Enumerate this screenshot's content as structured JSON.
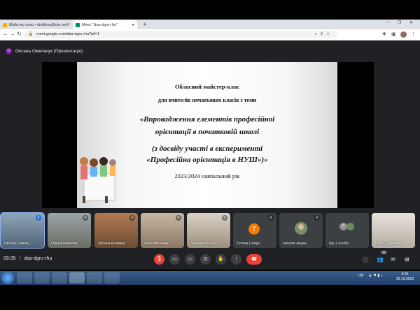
{
  "browser": {
    "tabs": [
      {
        "label": "Майстер клас • dishleva@ukr.net"
      },
      {
        "label": "Meet: \"dsa-dgru-rhu\""
      }
    ],
    "url": "meet.google.com/dsa-dgru-rhu?pli=1"
  },
  "meet": {
    "presenter": "Оксана Омельчук (Презентація)",
    "presenter_initial": "О",
    "slide": {
      "line1": "Обласний майстер-клас",
      "line2": "для вчителів початкових класів з теми",
      "line3": "«Впровадження елементів професійної",
      "line4": "орієнтації в початковій школі",
      "line5": "(з досвіду участі в експерименті",
      "line6": "«Професійна орієнтація в НУШ»)»",
      "line7": "2023/2024 навчальний рік"
    },
    "participants": [
      {
        "name": "Оксана Омель..."
      },
      {
        "name": "Олена Ковалев"
      },
      {
        "name": "Оксана Кравчук"
      },
      {
        "name": "Алла Мельник"
      },
      {
        "name": "Людмила Чаба..."
      },
      {
        "name": "Тетяна Снігур",
        "initial": "Т"
      },
      {
        "name": "наталія ліщин..."
      },
      {
        "name": "Ще 2 особи",
        "initial": "А"
      },
      {
        "name": "Ірина Дидалева"
      }
    ],
    "time": "09:35",
    "meeting_code": "dsa-dgru-rhu",
    "people_count": "11"
  },
  "taskbar": {
    "lang": "UK",
    "time": "9:35",
    "date": "26.10.2023"
  },
  "colors": {
    "accent_red": "#ea4335",
    "meet_bg": "#202124",
    "tile_bg": "#3c4043"
  }
}
